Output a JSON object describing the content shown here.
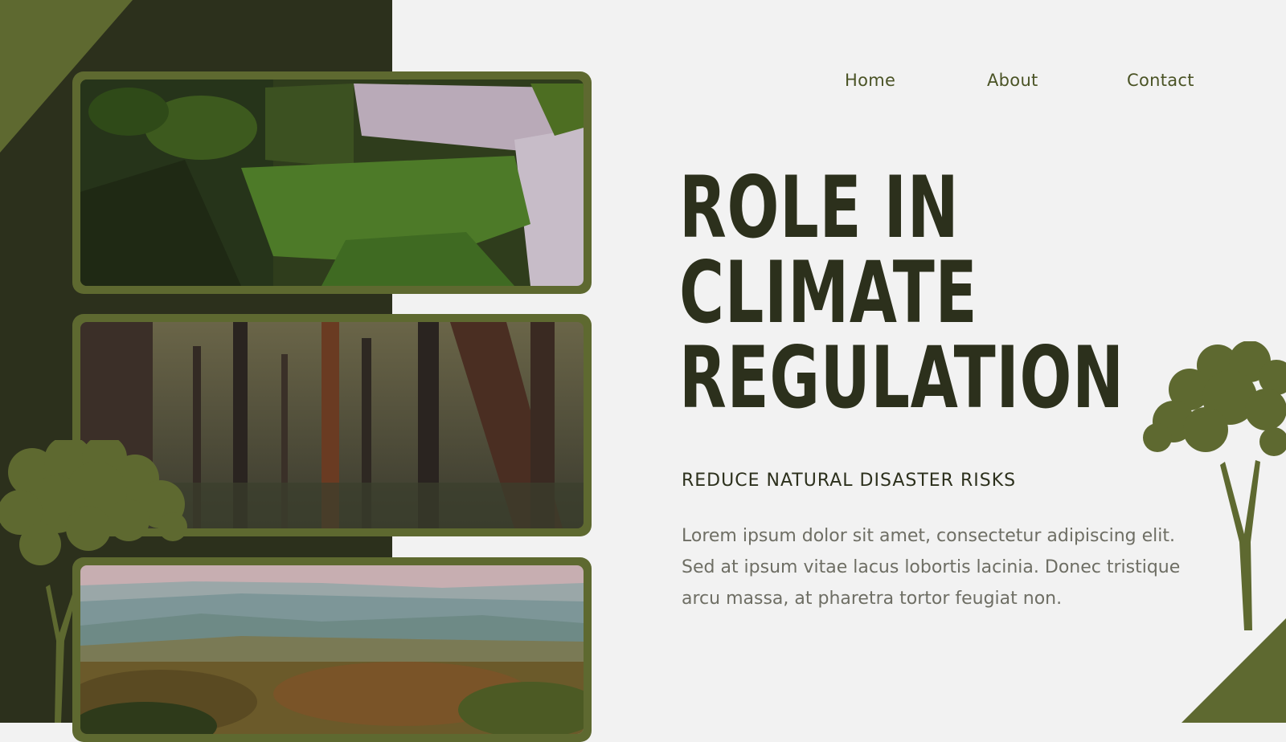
{
  "nav": {
    "home": "Home",
    "about": "About",
    "contact": "Contact"
  },
  "hero": {
    "title_lines": [
      "ROLE IN",
      "CLIMATE",
      "REGULATION"
    ],
    "subtitle": "REDUCE NATURAL DISASTER RISKS",
    "body": "Lorem ipsum dolor sit amet, consectetur adipiscing elit. Sed at ipsum vitae lacus lobortis lacinia. Donec tristique arcu massa, at pharetra tortor feugiat non."
  },
  "images": [
    {
      "subject": "mossy-waterfall-photo"
    },
    {
      "subject": "forest-trees-photo"
    },
    {
      "subject": "hills-landscape-photo"
    }
  ],
  "colors": {
    "dark_green": "#2c301c",
    "olive": "#5e6930",
    "background": "#f2f2f2",
    "nav_text": "#4a5325",
    "body_text": "#6e6e64"
  }
}
